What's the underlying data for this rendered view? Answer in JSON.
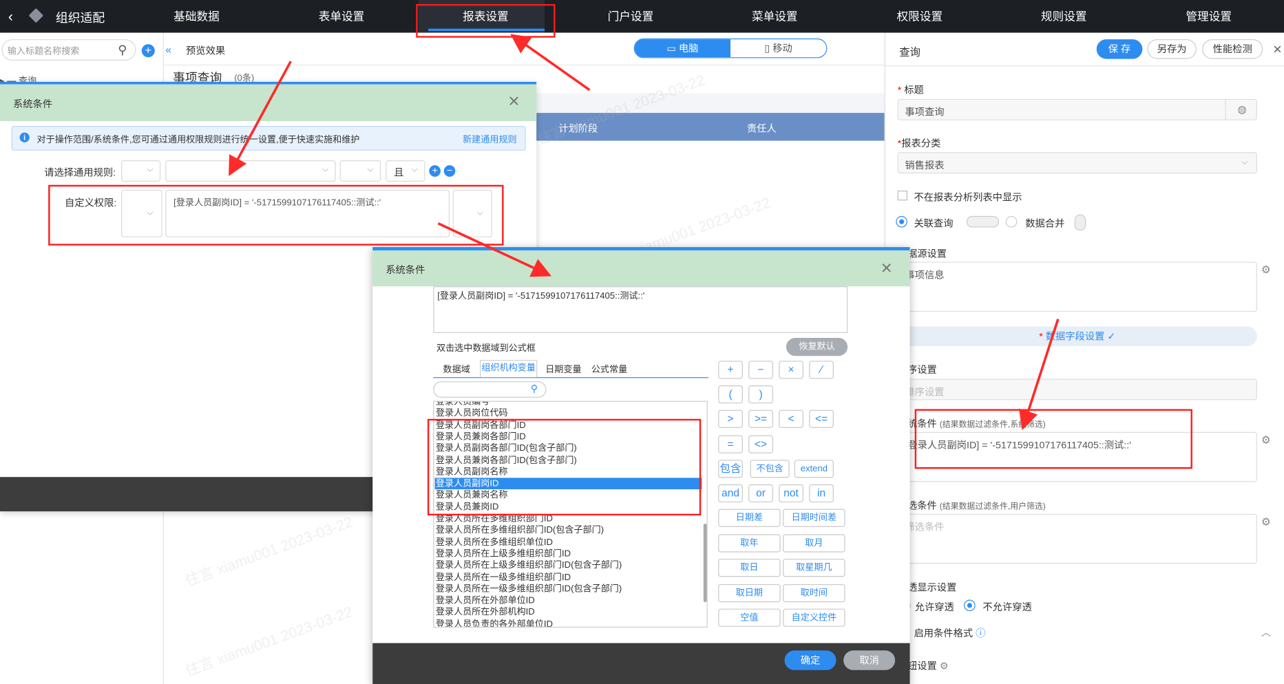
{
  "topnav": {
    "title": "组织适配",
    "items": [
      "基础数据",
      "表单设置",
      "报表设置",
      "门户设置",
      "菜单设置",
      "权限设置",
      "规则设置",
      "管理设置"
    ]
  },
  "sidebar": {
    "search_placeholder": "输入标题名称搜索",
    "tree_first": "查询"
  },
  "center": {
    "preview_label": "预览效果",
    "view_pc": "电脑",
    "view_mobile": "移动",
    "page_title": "事项查询",
    "page_count": "(0条)",
    "col_plan": "计划阶段",
    "col_owner": "责任人"
  },
  "right": {
    "header": "查询",
    "btn_save": "保 存",
    "btn_saveas": "另存为",
    "btn_perf": "性能检测",
    "label_title": "标题",
    "title_value": "事项查询",
    "label_category": "报表分类",
    "category_value": "销售报表",
    "not_show_label": "不在报表分析列表中显示",
    "relate_query": "关联查询",
    "data_merge": "数据合并",
    "label_source": "数据源设置",
    "source_value": "事项信息",
    "field_settings": "数据字段设置",
    "label_sort": "排序设置",
    "sort_placeholder": "排序设置",
    "label_sys_cond": "系统条件",
    "sys_cond_hint": "(结果数据过滤条件,系统筛选)",
    "sys_cond_value": "[登录人员副岗ID] = '-5171599107176117405::测试::'",
    "label_filter": "筛选条件",
    "filter_hint": "(结果数据过滤条件,用户筛选)",
    "filter_placeholder": "筛选条件",
    "label_penetrate": "穿透显示设置",
    "allow": "允许穿透",
    "disallow": "不允许穿透",
    "cond_format": "启用条件格式",
    "label_button": "按钮设置"
  },
  "modal1": {
    "title": "系统条件",
    "info": "对于操作范围/系统条件,您可通过通用权限规则进行统一设置,便于快速实施和维护",
    "new_rule": "新建通用规则",
    "rule_label": "请选择通用规则:",
    "rule_op": "且",
    "custom_label": "自定义权限:",
    "custom_value": "[登录人员副岗ID] = '-5171599107176117405::测试::'"
  },
  "modal2": {
    "title": "系统条件",
    "formula": "[登录人员副岗ID] = '-5171599107176117405::测试::'",
    "dbl_hint": "双击选中数据域到公式框",
    "restore": "恢复默认",
    "tabs": [
      "数据域",
      "组织机构变量",
      "日期变量",
      "公式常量"
    ],
    "list": [
      "登录人员编号",
      "登录人员岗位代码",
      "登录人员副岗各部门ID",
      "登录人员兼岗各部门ID",
      "登录人员副岗各部门ID(包含子部门)",
      "登录人员兼岗各部门ID(包含子部门)",
      "登录人员副岗名称",
      "登录人员副岗ID",
      "登录人员兼岗名称",
      "登录人员兼岗ID",
      "登录人员所在多维组织部门ID",
      "登录人员所在多维组织部门ID(包含子部门)",
      "登录人员所在多维组织单位ID",
      "登录人员所在上级多维组织部门ID",
      "登录人员所在上级多维组织部门ID(包含子部门)",
      "登录人员所在一级多维组织部门ID",
      "登录人员所在一级多维组织部门ID(包含子部门)",
      "登录人员所在外部单位ID",
      "登录人员所在外部机构ID",
      "登录人员负责的各外部单位ID"
    ],
    "ops_row1": [
      "+",
      "−",
      "×",
      "⁄"
    ],
    "ops_row2": [
      "(",
      ")"
    ],
    "ops_row3": [
      ">",
      ">=",
      "<",
      "<="
    ],
    "ops_row4": [
      "=",
      "<>"
    ],
    "ops_row5": [
      "包含",
      "不包含",
      "extend"
    ],
    "ops_row6": [
      "and",
      "or",
      "not",
      "in"
    ],
    "funcs": [
      "日期差",
      "日期时间差",
      "取年",
      "取月",
      "取日",
      "取星期几",
      "取日期",
      "取时间",
      "空值",
      "自定义控件"
    ],
    "confirm": "确定",
    "cancel": "取消"
  },
  "watermark": "住言  xiamu001  2023-03-22"
}
